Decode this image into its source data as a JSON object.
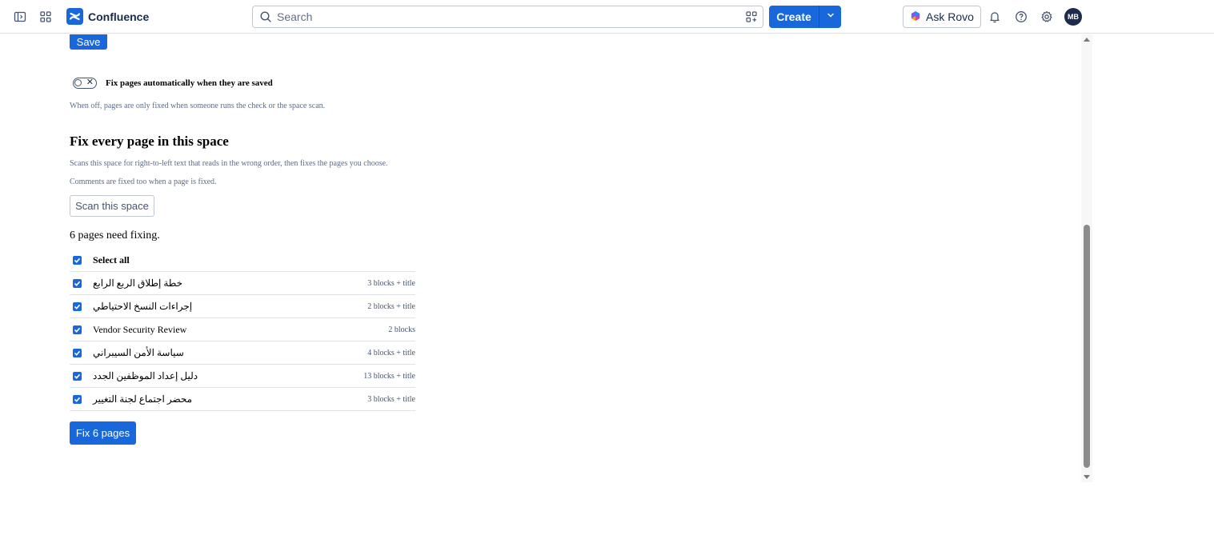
{
  "topnav": {
    "app_name": "Confluence",
    "search_placeholder": "Search",
    "create_label": "Create",
    "rovo_label": "Ask Rovo",
    "avatar_initials": "MB"
  },
  "content": {
    "save_label": "Save",
    "auto_fix_toggle": {
      "label": "Fix pages automatically when they are saved",
      "state": "off",
      "help": "When off, pages are only fixed when someone runs the check or the space scan."
    },
    "section_title": "Fix every page in this space",
    "section_desc_1": "Scans this space for right-to-left text that reads in the wrong order, then fixes the pages you choose.",
    "section_desc_2": "Comments are fixed too when a page is fixed.",
    "scan_label": "Scan this space",
    "result_text": "6 pages need fixing.",
    "select_all_label": "Select all",
    "pages": [
      {
        "title": "خطة إطلاق الربع الرابع",
        "meta": "3 blocks + title",
        "checked": true
      },
      {
        "title": "إجراءات النسخ الاحتياطي",
        "meta": "2 blocks + title",
        "checked": true
      },
      {
        "title": "Vendor Security Review",
        "meta": "2 blocks",
        "checked": true
      },
      {
        "title": "سياسة الأمن السيبراني",
        "meta": "4 blocks + title",
        "checked": true
      },
      {
        "title": "دليل إعداد الموظفين الجدد",
        "meta": "13 blocks + title",
        "checked": true
      },
      {
        "title": "محضر اجتماع لجنة التغيير",
        "meta": "3 blocks + title",
        "checked": true
      }
    ],
    "fix_label": "Fix 6 pages"
  },
  "colors": {
    "brand_blue": "#1868db",
    "text_dark": "#172b4d",
    "border": "#dfe1e6"
  }
}
